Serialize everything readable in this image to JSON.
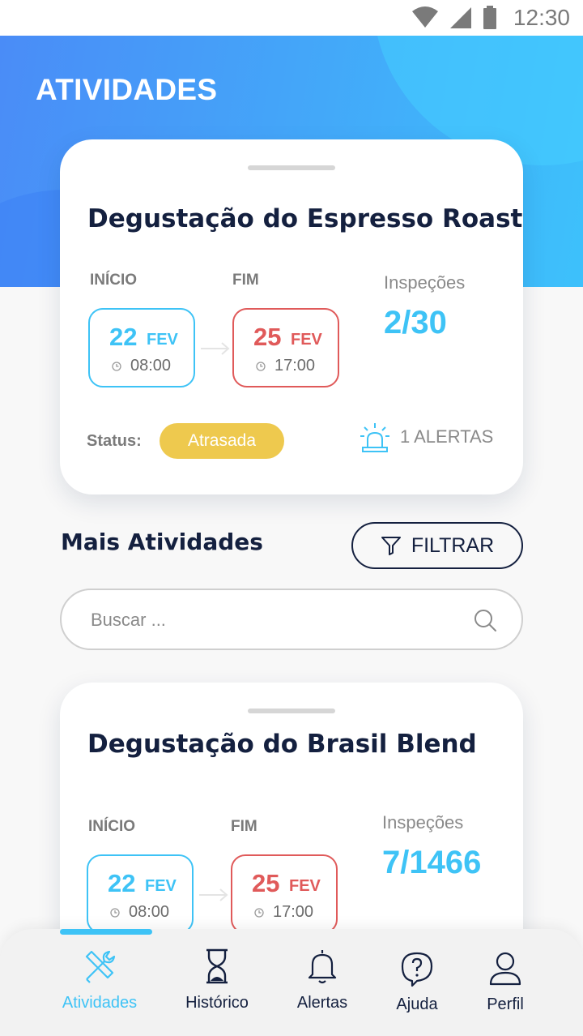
{
  "status_bar": {
    "time": "12:30"
  },
  "header": {
    "title": "ATIVIDADES"
  },
  "featured": {
    "title": "Degustação do Espresso Roast",
    "start_label": "INÍCIO",
    "end_label": "FIM",
    "start": {
      "day": "22",
      "month": "FEV",
      "time": "08:00"
    },
    "end": {
      "day": "25",
      "month": "FEV",
      "time": "17:00"
    },
    "inspections_label": "Inspeções",
    "inspections_value": "2/30",
    "status_label": "Status:",
    "status_value": "Atrasada",
    "alerts_text": "1 ALERTAS"
  },
  "more": {
    "title": "Mais Atividades",
    "filter_label": "FILTRAR",
    "search_placeholder": "Buscar ..."
  },
  "second": {
    "title": "Degustação do Brasil Blend",
    "start_label": "INÍCIO",
    "end_label": "FIM",
    "start": {
      "day": "22",
      "month": "FEV",
      "time": "08:00"
    },
    "end": {
      "day": "25",
      "month": "FEV",
      "time": "17:00"
    },
    "inspections_label": "Inspeções",
    "inspections_value": "7/1466"
  },
  "nav": {
    "items": [
      {
        "label": "Atividades",
        "icon": "tools-icon",
        "active": true
      },
      {
        "label": "Histórico",
        "icon": "hourglass-icon"
      },
      {
        "label": "Alertas",
        "icon": "bell-icon"
      },
      {
        "label": "Ajuda",
        "icon": "help-icon"
      },
      {
        "label": "Perfil",
        "icon": "user-icon"
      }
    ]
  },
  "colors": {
    "accent": "#3ec3f6",
    "danger": "#e05a5a",
    "warning": "#eec94e",
    "navy": "#14203f"
  }
}
